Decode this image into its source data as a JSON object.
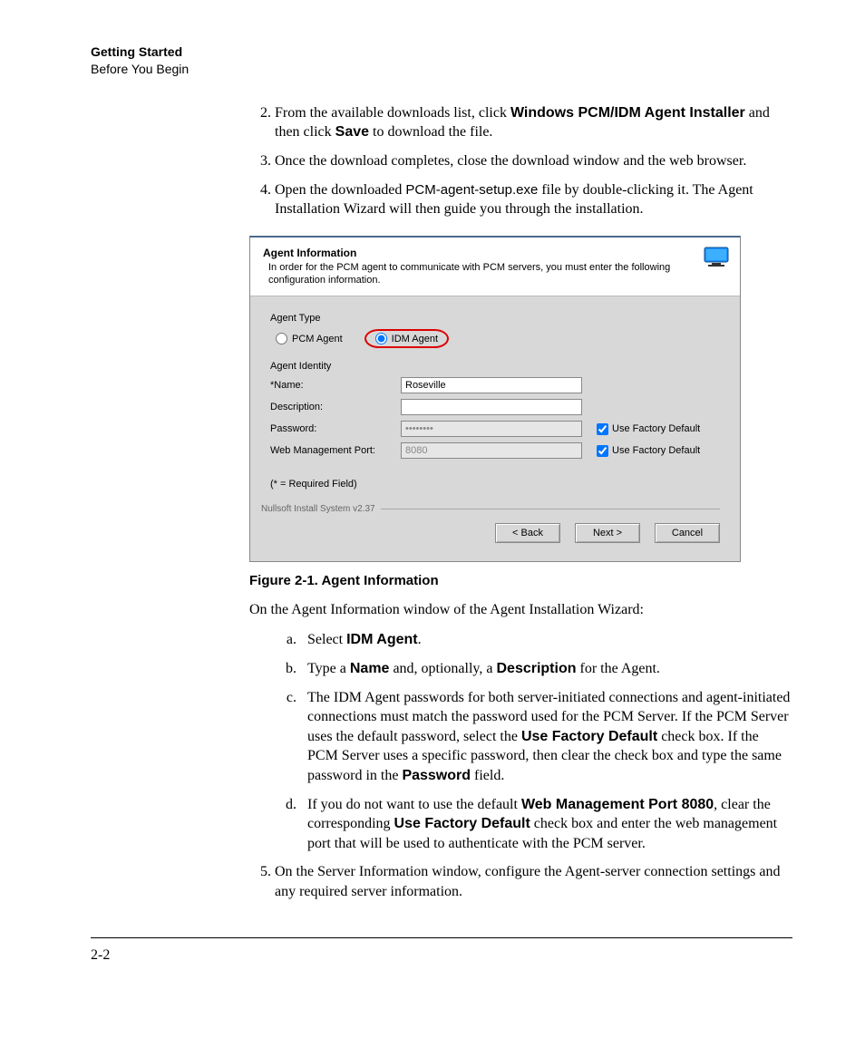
{
  "header": {
    "chapter": "Getting Started",
    "section": "Before You Begin"
  },
  "steps": {
    "s2_pre": "From the available downloads list, click ",
    "s2_bold1": "Windows PCM/IDM Agent Installer",
    "s2_mid": " and then click ",
    "s2_bold2": "Save",
    "s2_post": " to download the file.",
    "s3": "Once the download completes, close the download window and the web browser.",
    "s4_pre": "Open the downloaded ",
    "s4_file": "PCM-agent-setup.exe",
    "s4_post": " file by double-clicking it. The Agent Installation Wizard will then guide you through the installation.",
    "s5": "On the Server Information window, configure the Agent-server connection settings and any required server information."
  },
  "figure": {
    "caption": "Figure 2-1. Agent Information",
    "intro": "On the Agent Information window of the Agent Installation Wizard:"
  },
  "dialog": {
    "title": "Agent Information",
    "desc": "In order for the PCM agent to communicate with PCM servers, you must enter the following configuration information.",
    "agent_type_label": "Agent Type",
    "pcm_agent": "PCM Agent",
    "idm_agent": "IDM Agent",
    "agent_identity_label": "Agent Identity",
    "name_label": "*Name:",
    "name_value": "Roseville",
    "desc_label": "Description:",
    "password_label": "Password:",
    "password_value": "••••••••",
    "port_label": "Web Management Port:",
    "port_value": "8080",
    "use_default": "Use Factory Default",
    "req_note": "(* = Required Field)",
    "nullsoft": "Nullsoft Install System v2.37",
    "back": "< Back",
    "next": "Next >",
    "cancel": "Cancel"
  },
  "subs": {
    "a_pre": "Select ",
    "a_bold": "IDM Agent",
    "a_post": ".",
    "b_pre": "Type a ",
    "b_bold1": "Name",
    "b_mid": " and, optionally, a ",
    "b_bold2": "Description",
    "b_post": " for the Agent.",
    "c_pre": "The IDM Agent passwords for both server-initiated connections and agent-initiated connections must match the password used for the PCM Server. If the PCM Server uses the default password, select the ",
    "c_bold1": "Use Factory Default",
    "c_mid": " check box. If the PCM Server uses a specific password, then clear the check box and type the same password in the ",
    "c_bold2": "Password",
    "c_post": " field.",
    "d_pre": "If you do not want to use the default ",
    "d_bold1": "Web Management Port 8080",
    "d_mid": ", clear the corresponding ",
    "d_bold2": "Use Factory Default",
    "d_post": " check box and enter the web management port that will be used to authenticate with the PCM server."
  },
  "page_number": "2-2"
}
